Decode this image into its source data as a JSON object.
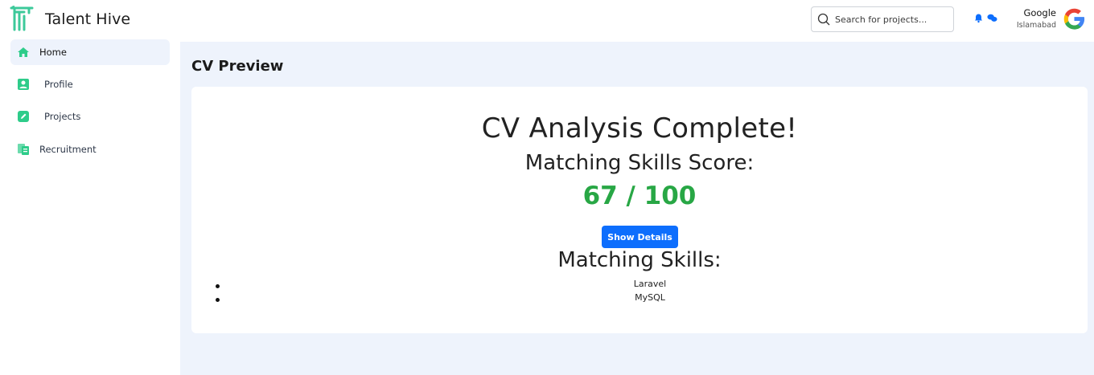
{
  "app": {
    "name": "Talent Hive"
  },
  "header": {
    "search_placeholder": "Search for projects...",
    "user": {
      "name": "Google",
      "location": "Islamabad"
    }
  },
  "sidebar": {
    "items": [
      {
        "label": "Home",
        "icon": "home-icon",
        "active": true
      },
      {
        "label": "Profile",
        "icon": "profile-icon",
        "active": false
      },
      {
        "label": "Projects",
        "icon": "edit-icon",
        "active": false
      },
      {
        "label": "Recruitment",
        "icon": "recruitment-icon",
        "active": false
      }
    ]
  },
  "main": {
    "title": "CV Preview",
    "analysis": {
      "heading": "CV Analysis Complete!",
      "score_label": "Matching Skills Score:",
      "score": "67 / 100",
      "details_button": "Show Details",
      "skills_heading": "Matching Skills:",
      "skills": [
        "Laravel",
        "MySQL"
      ]
    }
  },
  "colors": {
    "accent_green": "#28a745",
    "button_blue": "#0d6efd",
    "nav_icon_green": "#2ecc8a",
    "main_background": "#eef3fc"
  }
}
